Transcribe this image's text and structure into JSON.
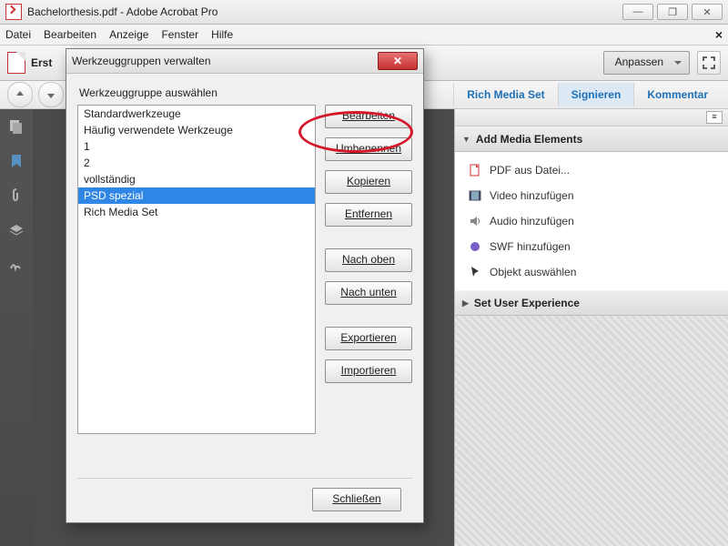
{
  "window": {
    "title": "Bachelorthesis.pdf - Adobe Acrobat Pro"
  },
  "menubar": {
    "items": [
      "Datei",
      "Bearbeiten",
      "Anzeige",
      "Fenster",
      "Hilfe"
    ]
  },
  "toolbar": {
    "first_btn": "Erst",
    "anpassen": "Anpassen"
  },
  "tabs": {
    "items": [
      "Rich Media Set",
      "Signieren",
      "Kommentar"
    ],
    "active_index": 1
  },
  "panel": {
    "section1": "Add Media Elements",
    "media_items": [
      "PDF aus Datei...",
      "Video hinzufügen",
      "Audio hinzufügen",
      "SWF hinzufügen",
      "Objekt auswählen"
    ],
    "section2": "Set User Experience"
  },
  "dialog": {
    "title": "Werkzeuggruppen verwalten",
    "select_label": "Werkzeuggruppe auswählen",
    "list": [
      "Standardwerkzeuge",
      "Häufig verwendete Werkzeuge",
      "1",
      "2",
      "vollständig",
      "PSD spezial",
      "Rich Media Set"
    ],
    "selected_index": 5,
    "buttons": {
      "edit": "Bearbeiten",
      "rename": "Umbenennen",
      "copy": "Kopieren",
      "remove": "Entfernen",
      "up": "Nach oben",
      "down": "Nach unten",
      "export": "Exportieren",
      "import": "Importieren",
      "close": "Schließen"
    }
  },
  "icons": {
    "min": "—",
    "max": "❐",
    "close": "✕"
  }
}
